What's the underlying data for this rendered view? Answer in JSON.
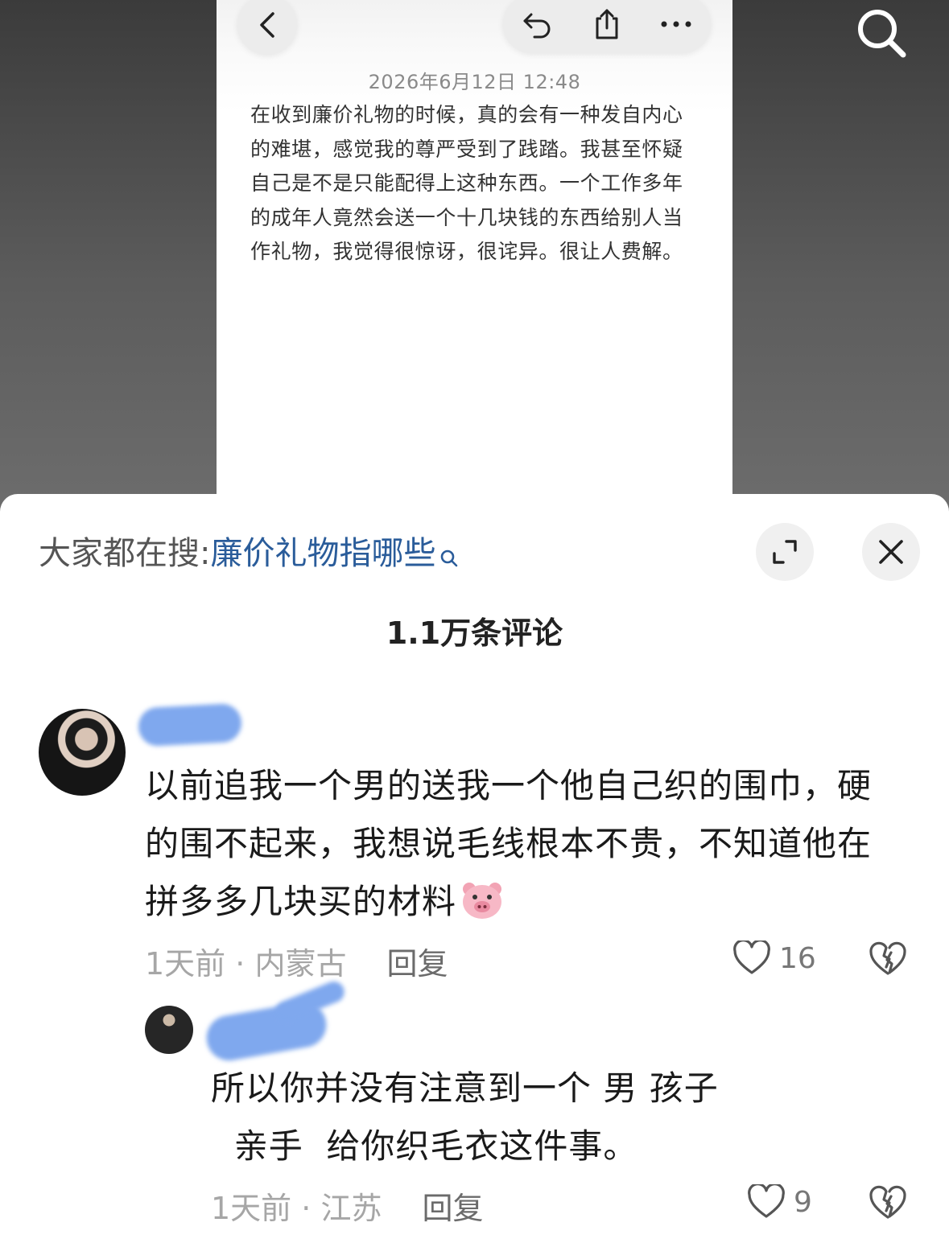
{
  "note": {
    "date": "2026年6月12日 12:48",
    "body": "在收到廉价礼物的时候，真的会有一种发自内心的难堪，感觉我的尊严受到了践踏。我甚至怀疑自己是不是只能配得上这种东西。一个工作多年的成年人竟然会送一个十几块钱的东西给别人当作礼物，我觉得很惊讶，很诧异。很让人费解。"
  },
  "icons": {
    "back": "chevron-left-icon",
    "undo": "undo-arrow-icon",
    "share": "share-icon",
    "more": "ellipsis-icon",
    "search": "search-icon",
    "expand": "expand-icon",
    "close": "close-icon",
    "like": "heart-icon",
    "dislike": "broken-heart-icon",
    "emoji": "pig-face-emoji"
  },
  "sheet": {
    "hot_prefix": "大家都在搜",
    "hot_colon": ":",
    "hot_term": "廉价礼物指哪些",
    "comment_count": "1.1万条评论"
  },
  "comments": [
    {
      "text": "以前追我一个男的送我一个他自己织的围巾，硬的围不起来，我想说毛线根本不贵，不知道他在拼多多几块买的材料",
      "time": "1天前",
      "separator": " · ",
      "location": "内蒙古",
      "reply_label": "回复",
      "likes": "16"
    },
    {
      "text": "所以你并没有注意到一个 男 孩子\n  亲手  给你织毛衣这件事。",
      "time": "1天前",
      "separator": " · ",
      "location": "江苏",
      "reply_label": "回复",
      "likes": "9"
    }
  ],
  "colors": {
    "hot_term": "#2a5c9a",
    "name_blur": "#7fa8ee"
  }
}
